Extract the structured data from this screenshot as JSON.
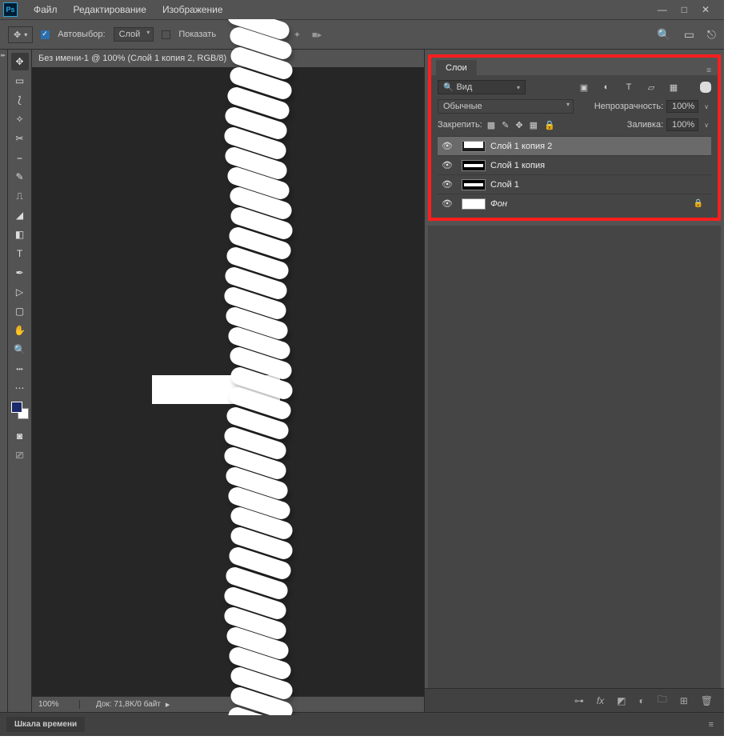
{
  "logo": "Ps",
  "menu": {
    "file": "Файл",
    "edit": "Редактирование",
    "image": "Изображение"
  },
  "win": {
    "min": "—",
    "max": "□",
    "close": "✕"
  },
  "options": {
    "move_icon": "✥",
    "autoselect_label": "Автовыбор:",
    "autoselect_value": "Слой",
    "show_label": "Показать",
    "align1": "≡",
    "align2": "⋮⋮",
    "transform": "⌗",
    "warp": "✦",
    "rec": "■▸",
    "search": "🔍",
    "panel": "▭",
    "share": "⎋"
  },
  "doc_tab": "Без имени-1 @ 100% (Слой 1 копия 2, RGB/8)",
  "status": {
    "zoom": "100%",
    "doc": "Док: 71,8K/0 байт"
  },
  "bottom": {
    "timeline": "Шкала времени"
  },
  "layers_panel": {
    "tab": "Слои",
    "search": "Вид",
    "blend": "Обычные",
    "opacity_label": "Непрозрачность:",
    "opacity_val": "100%",
    "lock_label": "Закрепить:",
    "fill_label": "Заливка:",
    "fill_val": "100%",
    "items": [
      {
        "name": "Слой 1 копия 2",
        "selected": true,
        "locked": false
      },
      {
        "name": "Слой 1 копия",
        "selected": false,
        "locked": false
      },
      {
        "name": "Слой 1",
        "selected": false,
        "locked": false
      },
      {
        "name": "Фон",
        "selected": false,
        "locked": true,
        "bg": true
      }
    ]
  }
}
